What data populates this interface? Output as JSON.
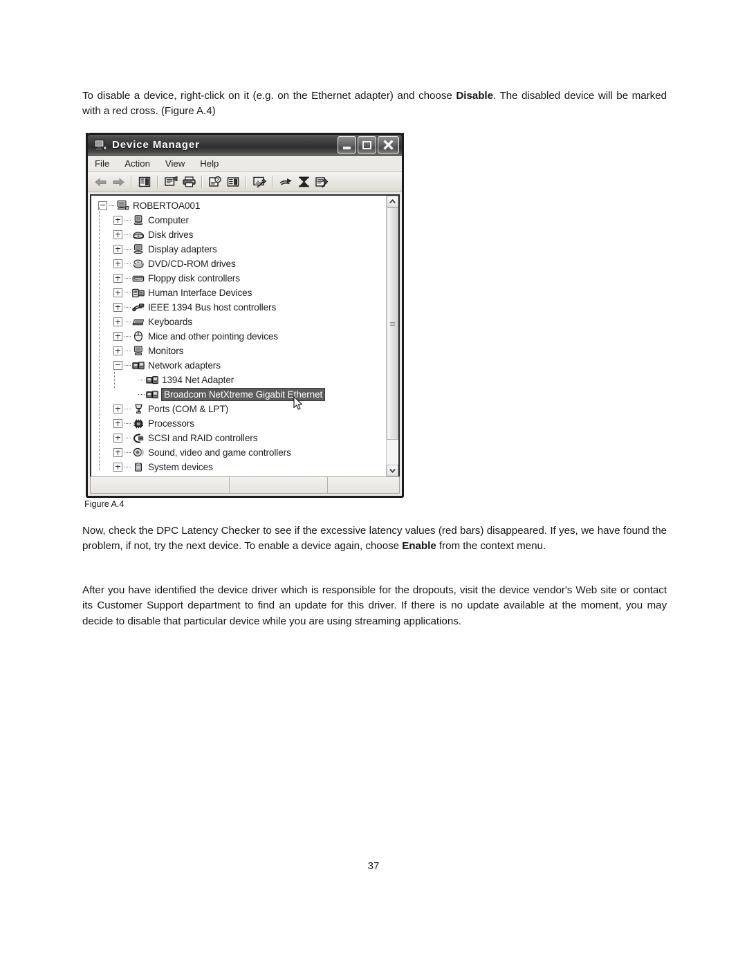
{
  "document": {
    "page_number": "37",
    "figure_caption": "Figure A.4",
    "paragraphs": {
      "intro_before_bold": "To disable a device, right-click on it (e.g. on the Ethernet adapter) and choose ",
      "intro_bold": "Disable",
      "intro_after_bold": ". The disabled device will be marked with a red cross. (Figure A.4)",
      "now_before_bold": "Now, check the DPC Latency Checker to see if the excessive latency values (red bars) disappeared. If yes, we have found the problem, if not, try the next device. To enable a device again, choose ",
      "now_bold": "Enable",
      "now_after_bold": " from the context menu.",
      "after": "After you have identified the device driver which is responsible for the dropouts, visit the device vendor's Web site or contact its Customer Support department to find an update for this driver. If there is no update available at the moment, you may decide to disable that particular device while you are using streaming applications."
    }
  },
  "device_manager": {
    "title": "Device Manager",
    "title_icon": "computer-monitor-icon",
    "window_buttons": [
      {
        "name": "minimize-button",
        "glyph": "minimize"
      },
      {
        "name": "maximize-button",
        "glyph": "maximize"
      },
      {
        "name": "close-button",
        "glyph": "close"
      }
    ],
    "menu": [
      "File",
      "Action",
      "View",
      "Help"
    ],
    "toolbar_icons": [
      "back-arrow-icon",
      "forward-arrow-icon",
      "show-hide-console-tree-icon",
      "properties-icon",
      "print-icon",
      "update-driver-icon",
      "show-device-details-icon",
      "scan-for-hardware-changes-icon",
      "uninstall-icon",
      "disable-device-icon",
      "enable-device-icon"
    ],
    "tree": [
      {
        "label": "ROBERTOA001",
        "level": 0,
        "box": "minus",
        "icon": "computer-root-icon",
        "selected": false
      },
      {
        "label": "Computer",
        "level": 1,
        "box": "plus",
        "icon": "computer-icon",
        "selected": false
      },
      {
        "label": "Disk drives",
        "level": 1,
        "box": "plus",
        "icon": "disk-drive-icon",
        "selected": false
      },
      {
        "label": "Display adapters",
        "level": 1,
        "box": "plus",
        "icon": "display-adapter-icon",
        "selected": false
      },
      {
        "label": "DVD/CD-ROM drives",
        "level": 1,
        "box": "plus",
        "icon": "dvd-drive-icon",
        "selected": false
      },
      {
        "label": "Floppy disk controllers",
        "level": 1,
        "box": "plus",
        "icon": "floppy-controller-icon",
        "selected": false
      },
      {
        "label": "Human Interface Devices",
        "level": 1,
        "box": "plus",
        "icon": "hid-icon",
        "selected": false
      },
      {
        "label": "IEEE 1394 Bus host controllers",
        "level": 1,
        "box": "plus",
        "icon": "ieee1394-icon",
        "selected": false
      },
      {
        "label": "Keyboards",
        "level": 1,
        "box": "plus",
        "icon": "keyboard-icon",
        "selected": false
      },
      {
        "label": "Mice and other pointing devices",
        "level": 1,
        "box": "plus",
        "icon": "mouse-icon",
        "selected": false
      },
      {
        "label": "Monitors",
        "level": 1,
        "box": "plus",
        "icon": "monitor-icon",
        "selected": false
      },
      {
        "label": "Network adapters",
        "level": 1,
        "box": "minus",
        "icon": "network-adapter-icon",
        "selected": false
      },
      {
        "label": "1394 Net Adapter",
        "level": 2,
        "box": "none",
        "icon": "network-adapter-icon",
        "selected": false
      },
      {
        "label": "Broadcom NetXtreme Gigabit Ethernet",
        "level": 2,
        "box": "none",
        "icon": "network-adapter-icon",
        "selected": true
      },
      {
        "label": "Ports (COM & LPT)",
        "level": 1,
        "box": "plus",
        "icon": "port-icon",
        "selected": false
      },
      {
        "label": "Processors",
        "level": 1,
        "box": "plus",
        "icon": "processor-icon",
        "selected": false
      },
      {
        "label": "SCSI and RAID controllers",
        "level": 1,
        "box": "plus",
        "icon": "scsi-raid-icon",
        "selected": false
      },
      {
        "label": "Sound, video and game controllers",
        "level": 1,
        "box": "plus",
        "icon": "sound-video-icon",
        "selected": false
      },
      {
        "label": "System devices",
        "level": 1,
        "box": "plus",
        "icon": "system-device-icon",
        "selected": false
      }
    ],
    "scrollbar": {
      "up_arrow": "scroll-up-arrow-icon",
      "down_arrow": "scroll-down-arrow-icon"
    },
    "status_bar_panes": [
      "",
      "",
      ""
    ],
    "cursor": "mouse-arrow-cursor"
  },
  "colors": {
    "selection_background": "#5d5d5d",
    "titlebar_dark": "#2e2e2e",
    "window_border": "#1b1b1b",
    "chrome_face": "#eceae6"
  }
}
